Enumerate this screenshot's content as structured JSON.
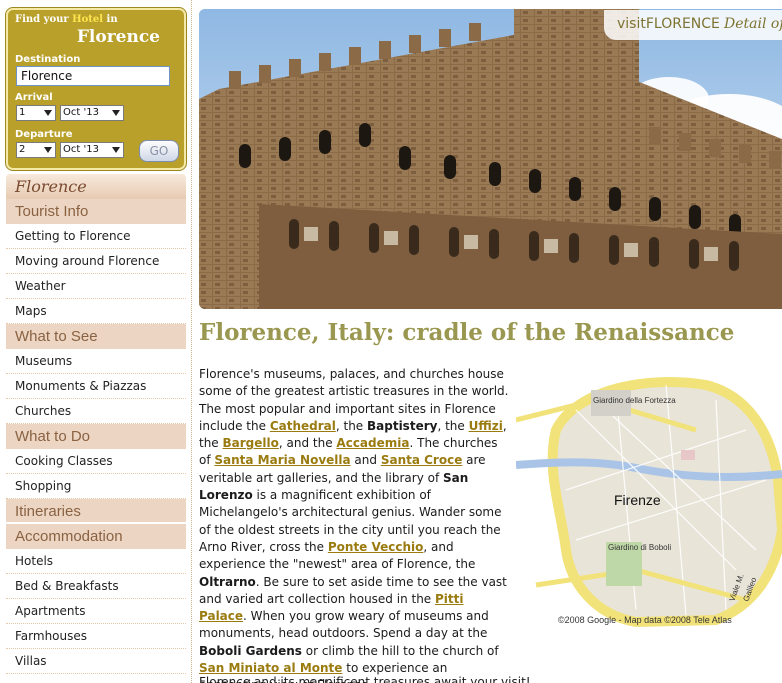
{
  "hotel_search": {
    "find_prefix": "Find your",
    "find_hotel": "Hotel",
    "find_suffix": "in",
    "city": "Florence",
    "destination_label": "Destination",
    "destination_value": "Florence",
    "arrival_label": "Arrival",
    "arrival_day": "1",
    "arrival_month": "Oct '13",
    "departure_label": "Departure",
    "departure_day": "2",
    "departure_month": "Oct '13",
    "go_label": "GO"
  },
  "nav": {
    "top": "Florence",
    "sections": [
      {
        "head": "Tourist Info",
        "items": [
          "Getting to Florence",
          "Moving around Florence",
          "Weather",
          "Maps"
        ]
      },
      {
        "head": "What to See",
        "items": [
          "Museums",
          "Monuments & Piazzas",
          "Churches"
        ]
      },
      {
        "head": "What to Do",
        "items": [
          "Cooking Classes",
          "Shopping"
        ]
      },
      {
        "head": "Itineraries",
        "items": []
      },
      {
        "head": "Accommodation",
        "items": [
          "Hotels",
          "Bed & Breakfasts",
          "Apartments",
          "Farmhouses",
          "Villas"
        ]
      }
    ]
  },
  "brand": {
    "visit": "visitFLORENCE",
    "detail": "Detail of"
  },
  "page_title": "Florence, Italy: cradle of the Renaissance",
  "body": {
    "t1": "Florence's museums, palaces, and churches house some of the greatest artistic treasures in the world. The most popular and important sites in Florence include the ",
    "l_cathedral": "Cathedral",
    "t2": ", the ",
    "b_baptistery": "Baptistery",
    "t3": ", the ",
    "l_uffizi": "Uffizi",
    "t4": ", the ",
    "l_bargello": "Bargello",
    "t5": ", and the ",
    "l_accademia": "Accademia",
    "t6": ". The churches of ",
    "l_smn": "Santa Maria Novella",
    "t7": " and ",
    "l_scroce": "Santa Croce",
    "t8": " are veritable art galleries, and the library of ",
    "b_slorenzo": "San Lorenzo",
    "t9": " is a magnificent exhibition of Michelangelo's architectural genius. Wander some of the oldest streets in the city until you reach the Arno River, cross the ",
    "l_pontevecchio": "Ponte Vecchio",
    "t10": ", and experience the \"newest\" area of Florence, the ",
    "b_oltrarno": "Oltrarno",
    "t11": ". Be sure to set aside time to see the vast and varied art collection housed in the ",
    "l_pitti": "Pitti Palace",
    "t12": ". When you grow weary of museums and monuments, head outdoors. Spend a day at the ",
    "b_boboli": "Boboli Gardens",
    "t13": " or climb the hill to the church of ",
    "l_sanminiato": "San Miniato al Monte",
    "t14": " to experience an enchanting view of Florence.",
    "footline": "Florence and its magnificent treasures await your visit!"
  },
  "map": {
    "label_fortezza": "Giardino della Fortezza",
    "label_city": "Firenze",
    "label_boboli": "Giardino di Boboli",
    "label_viale": "Viale M.",
    "label_galileo": "Galileo",
    "credit": "©2008 Google - Map data ©2008 Tele Atlas"
  },
  "colors": {
    "accent_gold": "#b8a02a",
    "nav_head": "#ecd6c3",
    "link": "#9a7b10",
    "title": "#9a9750"
  }
}
